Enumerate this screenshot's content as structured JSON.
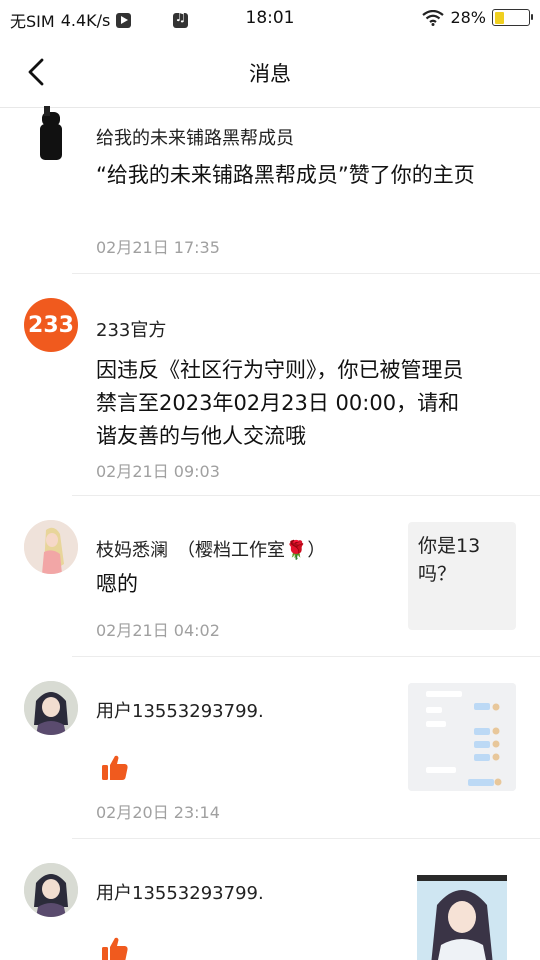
{
  "status_bar": {
    "sim": "无SIM",
    "speed": "4.4K/s",
    "time": "18:01",
    "battery_text": "28%",
    "battery_level": 0.28
  },
  "header": {
    "title": "消息"
  },
  "messages": [
    {
      "name": "给我的未来铺路黑帮成员",
      "content": "“给我的未来铺路黑帮成员”赞了你的主页",
      "time": "02月21日 17:35"
    },
    {
      "avatar_text": "233",
      "name": "233官方",
      "content": "因违反《社区行为守则》，你已被管理员禁言至2023年02月23日 00:00，请和谐友善的与他人交流哦",
      "time": "02月21日 09:03"
    },
    {
      "name": "枝妈悉澜　（樱档工作室🌹）",
      "content": "嗯的",
      "time": "02月21日 04:02",
      "thumb_text": "你是13吗？"
    },
    {
      "name": "用户13553293799.",
      "time": "02月20日 23:14"
    },
    {
      "name": "用户13553293799."
    }
  ],
  "colors": {
    "accent": "#f05a1e",
    "time_gray": "#a0a0a0",
    "divider": "#ececec"
  }
}
